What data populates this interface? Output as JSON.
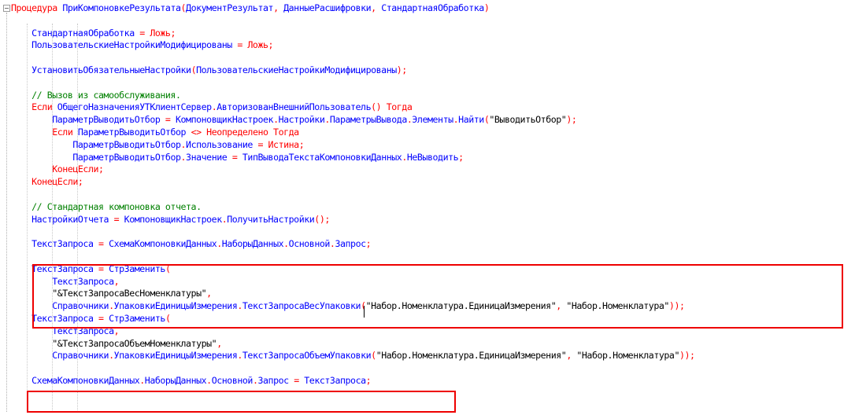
{
  "colors": {
    "keyword": "#ff0000",
    "identifier": "#0000ff",
    "comment": "#008000",
    "string": "#000000",
    "highlight_box": "#ee0000"
  },
  "lines": [
    [
      {
        "t": "Процедура ",
        "c": "kw"
      },
      {
        "t": "ПриКомпоновкеРезультата",
        "c": "id"
      },
      {
        "t": "(",
        "c": "op"
      },
      {
        "t": "ДокументРезультат",
        "c": "id"
      },
      {
        "t": ", ",
        "c": "op"
      },
      {
        "t": "ДанныеРасшифровки",
        "c": "id"
      },
      {
        "t": ", ",
        "c": "op"
      },
      {
        "t": "СтандартнаяОбработка",
        "c": "id"
      },
      {
        "t": ")",
        "c": "op"
      }
    ],
    [],
    [
      {
        "t": "    "
      },
      {
        "t": "СтандартнаяОбработка",
        "c": "id"
      },
      {
        "t": " = ",
        "c": "op"
      },
      {
        "t": "Ложь",
        "c": "kw"
      },
      {
        "t": ";",
        "c": "op"
      }
    ],
    [
      {
        "t": "    "
      },
      {
        "t": "ПользовательскиеНастройкиМодифицированы",
        "c": "id"
      },
      {
        "t": " = ",
        "c": "op"
      },
      {
        "t": "Ложь",
        "c": "kw"
      },
      {
        "t": ";",
        "c": "op"
      }
    ],
    [],
    [
      {
        "t": "    "
      },
      {
        "t": "УстановитьОбязательныеНастройки",
        "c": "id"
      },
      {
        "t": "(",
        "c": "op"
      },
      {
        "t": "ПользовательскиеНастройкиМодифицированы",
        "c": "id"
      },
      {
        "t": ");",
        "c": "op"
      }
    ],
    [],
    [
      {
        "t": "    "
      },
      {
        "t": "// Вызов из самообслуживания.",
        "c": "cmt"
      }
    ],
    [
      {
        "t": "    "
      },
      {
        "t": "Если ",
        "c": "kw"
      },
      {
        "t": "ОбщегоНазначенияУТКлиентСервер",
        "c": "id"
      },
      {
        "t": ".",
        "c": "op"
      },
      {
        "t": "АвторизованВнешнийПользователь",
        "c": "id"
      },
      {
        "t": "() ",
        "c": "op"
      },
      {
        "t": "Тогда",
        "c": "kw"
      }
    ],
    [
      {
        "t": "        "
      },
      {
        "t": "ПараметрВыводитьОтбор",
        "c": "id"
      },
      {
        "t": " = ",
        "c": "op"
      },
      {
        "t": "КомпоновщикНастроек",
        "c": "id"
      },
      {
        "t": ".",
        "c": "op"
      },
      {
        "t": "Настройки",
        "c": "id"
      },
      {
        "t": ".",
        "c": "op"
      },
      {
        "t": "ПараметрыВывода",
        "c": "id"
      },
      {
        "t": ".",
        "c": "op"
      },
      {
        "t": "Элементы",
        "c": "id"
      },
      {
        "t": ".",
        "c": "op"
      },
      {
        "t": "Найти",
        "c": "id"
      },
      {
        "t": "(",
        "c": "op"
      },
      {
        "t": "\"ВыводитьОтбор\"",
        "c": "str"
      },
      {
        "t": ");",
        "c": "op"
      }
    ],
    [
      {
        "t": "        "
      },
      {
        "t": "Если ",
        "c": "kw"
      },
      {
        "t": "ПараметрВыводитьОтбор",
        "c": "id"
      },
      {
        "t": " <> ",
        "c": "op"
      },
      {
        "t": "Неопределено Тогда",
        "c": "kw"
      }
    ],
    [
      {
        "t": "            "
      },
      {
        "t": "ПараметрВыводитьОтбор",
        "c": "id"
      },
      {
        "t": ".",
        "c": "op"
      },
      {
        "t": "Использование",
        "c": "id"
      },
      {
        "t": " = ",
        "c": "op"
      },
      {
        "t": "Истина",
        "c": "kw"
      },
      {
        "t": ";",
        "c": "op"
      }
    ],
    [
      {
        "t": "            "
      },
      {
        "t": "ПараметрВыводитьОтбор",
        "c": "id"
      },
      {
        "t": ".",
        "c": "op"
      },
      {
        "t": "Значение",
        "c": "id"
      },
      {
        "t": " = ",
        "c": "op"
      },
      {
        "t": "ТипВыводаТекстаКомпоновкиДанных",
        "c": "id"
      },
      {
        "t": ".",
        "c": "op"
      },
      {
        "t": "НеВыводить",
        "c": "id"
      },
      {
        "t": ";",
        "c": "op"
      }
    ],
    [
      {
        "t": "        "
      },
      {
        "t": "КонецЕсли",
        "c": "kw"
      },
      {
        "t": ";",
        "c": "op"
      }
    ],
    [
      {
        "t": "    "
      },
      {
        "t": "КонецЕсли",
        "c": "kw"
      },
      {
        "t": ";",
        "c": "op"
      }
    ],
    [],
    [
      {
        "t": "    "
      },
      {
        "t": "// Стандартная компоновка отчета.",
        "c": "cmt"
      }
    ],
    [
      {
        "t": "    "
      },
      {
        "t": "НастройкиОтчета",
        "c": "id"
      },
      {
        "t": " = ",
        "c": "op"
      },
      {
        "t": "КомпоновщикНастроек",
        "c": "id"
      },
      {
        "t": ".",
        "c": "op"
      },
      {
        "t": "ПолучитьНастройки",
        "c": "id"
      },
      {
        "t": "();",
        "c": "op"
      }
    ],
    [],
    [
      {
        "t": "    "
      },
      {
        "t": "ТекстЗапроса",
        "c": "id"
      },
      {
        "t": " = ",
        "c": "op"
      },
      {
        "t": "СхемаКомпоновкиДанных",
        "c": "id"
      },
      {
        "t": ".",
        "c": "op"
      },
      {
        "t": "НаборыДанных",
        "c": "id"
      },
      {
        "t": ".",
        "c": "op"
      },
      {
        "t": "Основной",
        "c": "id"
      },
      {
        "t": ".",
        "c": "op"
      },
      {
        "t": "Запрос",
        "c": "id"
      },
      {
        "t": ";",
        "c": "op"
      }
    ],
    [],
    [
      {
        "t": "    "
      },
      {
        "t": "ТекстЗапроса",
        "c": "id"
      },
      {
        "t": " = ",
        "c": "op"
      },
      {
        "t": "СтрЗаменить",
        "c": "id"
      },
      {
        "t": "(",
        "c": "op"
      }
    ],
    [
      {
        "t": "        "
      },
      {
        "t": "ТекстЗапроса",
        "c": "id"
      },
      {
        "t": ",",
        "c": "op"
      }
    ],
    [
      {
        "t": "        "
      },
      {
        "t": "\"&ТекстЗапросаВесНоменклатуры\"",
        "c": "str"
      },
      {
        "t": ",",
        "c": "op"
      }
    ],
    [
      {
        "t": "        "
      },
      {
        "t": "Справочники",
        "c": "id"
      },
      {
        "t": ".",
        "c": "op"
      },
      {
        "t": "УпаковкиЕдиницыИзмерения",
        "c": "id"
      },
      {
        "t": ".",
        "c": "op"
      },
      {
        "t": "ТекстЗапросаВесУпаковки",
        "c": "id"
      },
      {
        "t": "(",
        "c": "op"
      },
      {
        "t": "\"Набор.Номенклатура.ЕдиницаИзмерения\"",
        "c": "str"
      },
      {
        "t": ", ",
        "c": "op"
      },
      {
        "t": "\"Набор.Номенклатура\"",
        "c": "str"
      },
      {
        "t": "));",
        "c": "op"
      }
    ],
    [
      {
        "t": "    "
      },
      {
        "t": "ТекстЗапроса",
        "c": "id"
      },
      {
        "t": " = ",
        "c": "op"
      },
      {
        "t": "СтрЗаменить",
        "c": "id"
      },
      {
        "t": "(",
        "c": "op"
      }
    ],
    [
      {
        "t": "        "
      },
      {
        "t": "ТекстЗапроса",
        "c": "id"
      },
      {
        "t": ",",
        "c": "op"
      }
    ],
    [
      {
        "t": "        "
      },
      {
        "t": "\"&ТекстЗапросаОбъемНоменклатуры\"",
        "c": "str"
      },
      {
        "t": ",",
        "c": "op"
      }
    ],
    [
      {
        "t": "        "
      },
      {
        "t": "Справочники",
        "c": "id"
      },
      {
        "t": ".",
        "c": "op"
      },
      {
        "t": "УпаковкиЕдиницыИзмерения",
        "c": "id"
      },
      {
        "t": ".",
        "c": "op"
      },
      {
        "t": "ТекстЗапросаОбъемУпаковки",
        "c": "id"
      },
      {
        "t": "(",
        "c": "op"
      },
      {
        "t": "\"Набор.Номенклатура.ЕдиницаИзмерения\"",
        "c": "str"
      },
      {
        "t": ", ",
        "c": "op"
      },
      {
        "t": "\"Набор.Номенклатура\"",
        "c": "str"
      },
      {
        "t": "));",
        "c": "op"
      }
    ],
    [],
    [
      {
        "t": "    "
      },
      {
        "t": "СхемаКомпоновкиДанных",
        "c": "id"
      },
      {
        "t": ".",
        "c": "op"
      },
      {
        "t": "НаборыДанных",
        "c": "id"
      },
      {
        "t": ".",
        "c": "op"
      },
      {
        "t": "Основной",
        "c": "id"
      },
      {
        "t": ".",
        "c": "op"
      },
      {
        "t": "Запрос",
        "c": "id"
      },
      {
        "t": " = ",
        "c": "op"
      },
      {
        "t": "ТекстЗапроса",
        "c": "id"
      },
      {
        "t": ";",
        "c": "op"
      }
    ]
  ]
}
